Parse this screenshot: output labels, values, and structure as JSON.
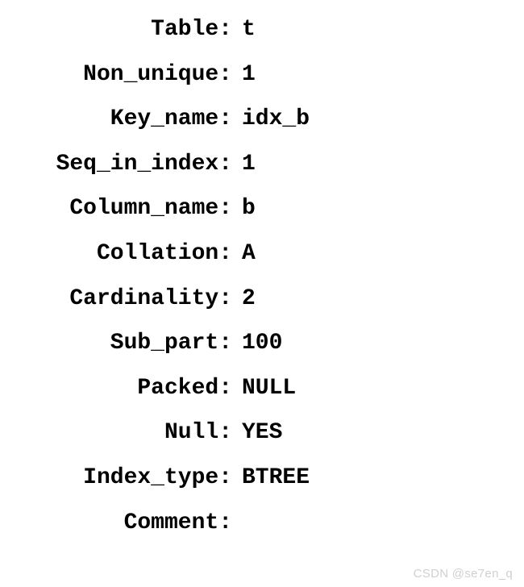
{
  "rows": [
    {
      "label": "Table:",
      "value": "t"
    },
    {
      "label": "Non_unique:",
      "value": "1"
    },
    {
      "label": "Key_name:",
      "value": "idx_b"
    },
    {
      "label": "Seq_in_index:",
      "value": "1"
    },
    {
      "label": "Column_name:",
      "value": "b"
    },
    {
      "label": "Collation:",
      "value": "A"
    },
    {
      "label": "Cardinality:",
      "value": "2"
    },
    {
      "label": "Sub_part:",
      "value": "100"
    },
    {
      "label": "Packed:",
      "value": "NULL"
    },
    {
      "label": "Null:",
      "value": "YES"
    },
    {
      "label": "Index_type:",
      "value": "BTREE"
    },
    {
      "label": "Comment:",
      "value": ""
    }
  ],
  "watermark": "CSDN @se7en_q"
}
